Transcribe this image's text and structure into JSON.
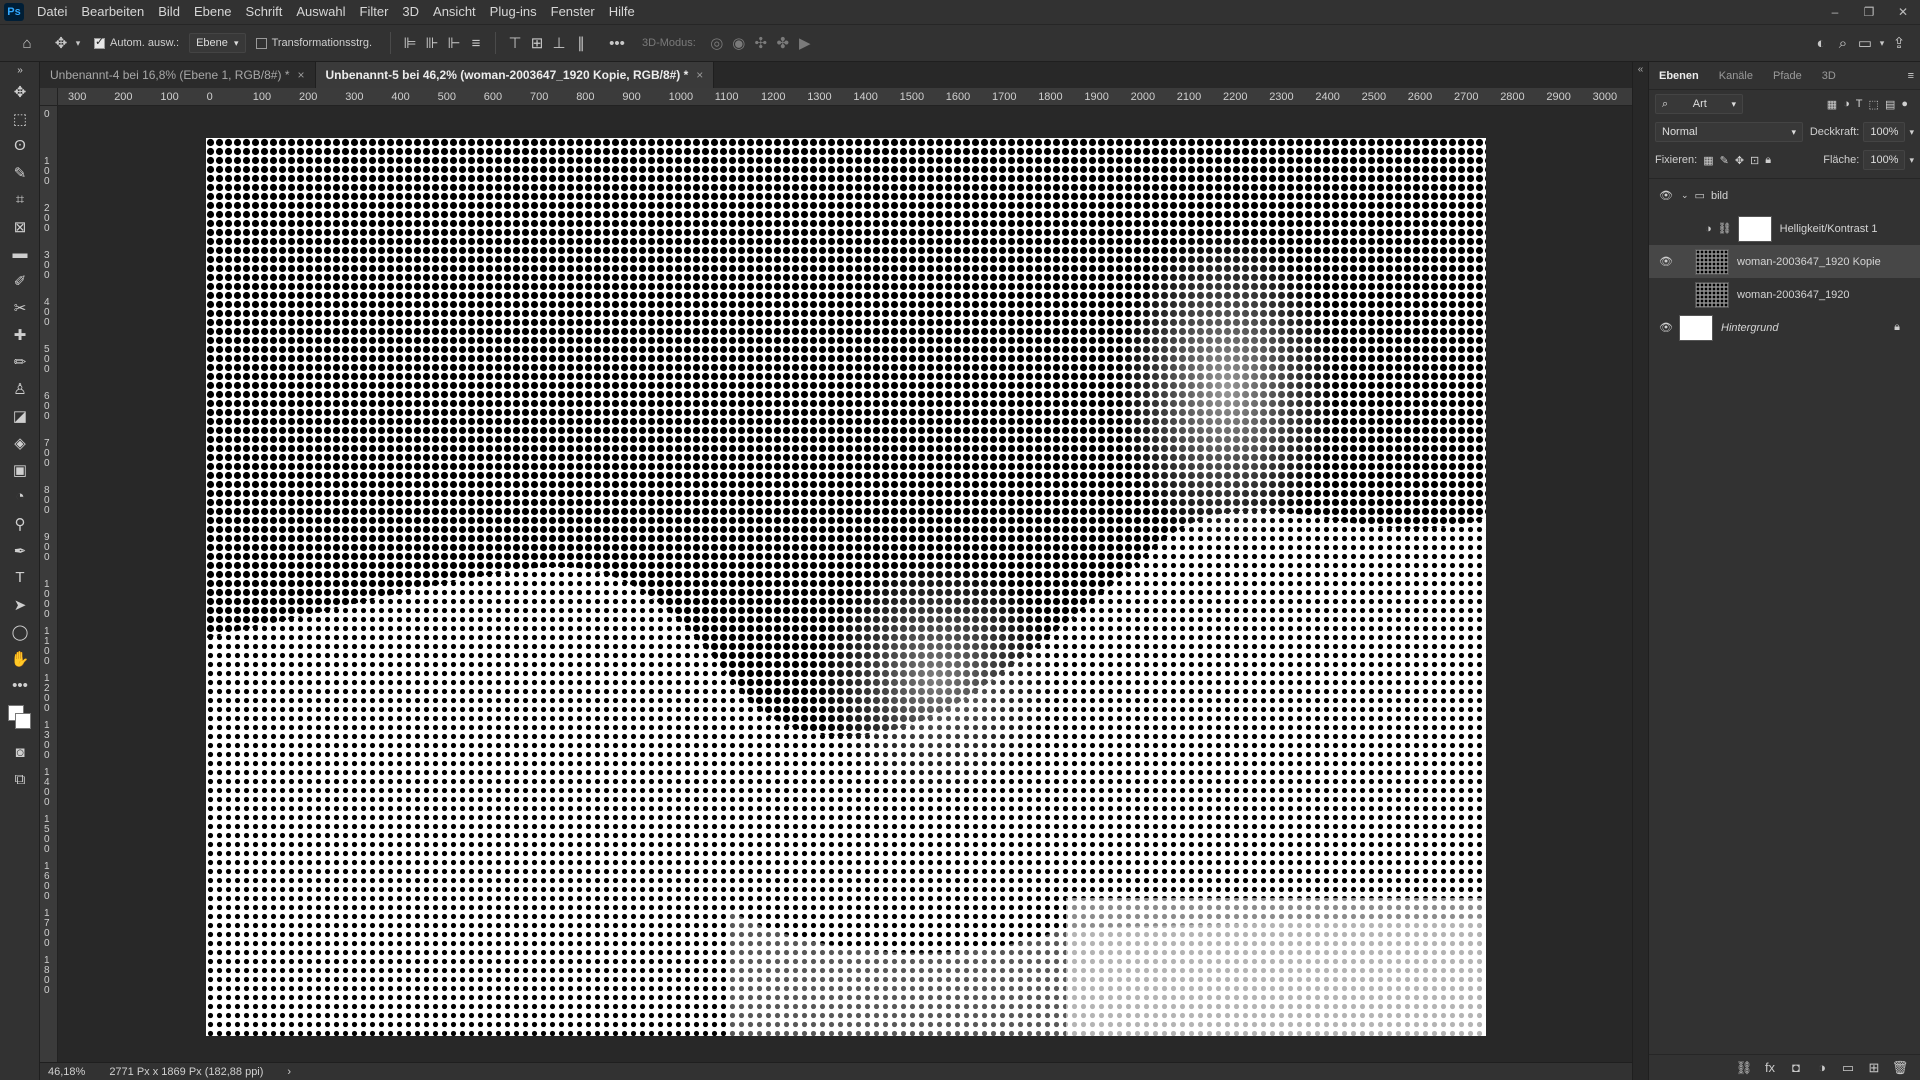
{
  "app": {
    "logo": "Ps",
    "menu": [
      "Datei",
      "Bearbeiten",
      "Bild",
      "Ebene",
      "Schrift",
      "Auswahl",
      "Filter",
      "3D",
      "Ansicht",
      "Plug-ins",
      "Fenster",
      "Hilfe"
    ],
    "window_controls": {
      "minimize": "–",
      "restore": "❐",
      "close": "✕"
    }
  },
  "options": {
    "auto_select_label": "Autom. ausw.:",
    "auto_select_target": "Ebene",
    "transform_label": "Transformationsstrg.",
    "mode_3d_label": "3D-Modus:"
  },
  "tabs": [
    {
      "label": "Unbenannt-4 bei 16,8% (Ebene 1, RGB/8#) *",
      "active": false
    },
    {
      "label": "Unbenannt-5 bei 46,2% (woman-2003647_1920 Kopie, RGB/8#) *",
      "active": true
    }
  ],
  "ruler_h": [
    "300",
    "200",
    "100",
    "0",
    "100",
    "200",
    "300",
    "400",
    "500",
    "600",
    "700",
    "800",
    "900",
    "1000",
    "1100",
    "1200",
    "1300",
    "1400",
    "1500",
    "1600",
    "1700",
    "1800",
    "1900",
    "2000",
    "2100",
    "2200",
    "2300",
    "2400",
    "2500",
    "2600",
    "2700",
    "2800",
    "2900",
    "3000"
  ],
  "ruler_v": [
    "0",
    "1\n0\n0",
    "2\n0\n0",
    "3\n0\n0",
    "4\n0\n0",
    "5\n0\n0",
    "6\n0\n0",
    "7\n0\n0",
    "8\n0\n0",
    "9\n0\n0",
    "1\n0\n0\n0",
    "1\n1\n0\n0",
    "1\n2\n0\n0",
    "1\n3\n0\n0",
    "1\n4\n0\n0",
    "1\n5\n0\n0",
    "1\n6\n0\n0",
    "1\n7\n0\n0",
    "1\n8\n0\n0"
  ],
  "status": {
    "zoom": "46,18%",
    "doc_info": "2771 Px x 1869 Px (182,88 ppi)",
    "arrow": "›"
  },
  "panel": {
    "tabs": [
      "Ebenen",
      "Kanäle",
      "Pfade",
      "3D"
    ],
    "filter_kind": "Art",
    "blend_mode": "Normal",
    "opacity_label": "Deckkraft:",
    "opacity_value": "100%",
    "lock_label": "Fixieren:",
    "fill_label": "Fläche:",
    "fill_value": "100%",
    "layers": [
      {
        "name": "bild",
        "type": "group",
        "visible": true,
        "selected": false
      },
      {
        "name": "Helligkeit/Kontrast 1",
        "type": "adjustment",
        "visible": false,
        "selected": false
      },
      {
        "name": "woman-2003647_1920 Kopie",
        "type": "image",
        "visible": true,
        "selected": true
      },
      {
        "name": "woman-2003647_1920",
        "type": "image",
        "visible": false,
        "selected": false
      },
      {
        "name": "Hintergrund",
        "type": "background",
        "visible": true,
        "selected": false
      }
    ]
  },
  "colors": {
    "menubar": "#323232",
    "workspace": "#282828",
    "accent": "#31a8ff"
  }
}
